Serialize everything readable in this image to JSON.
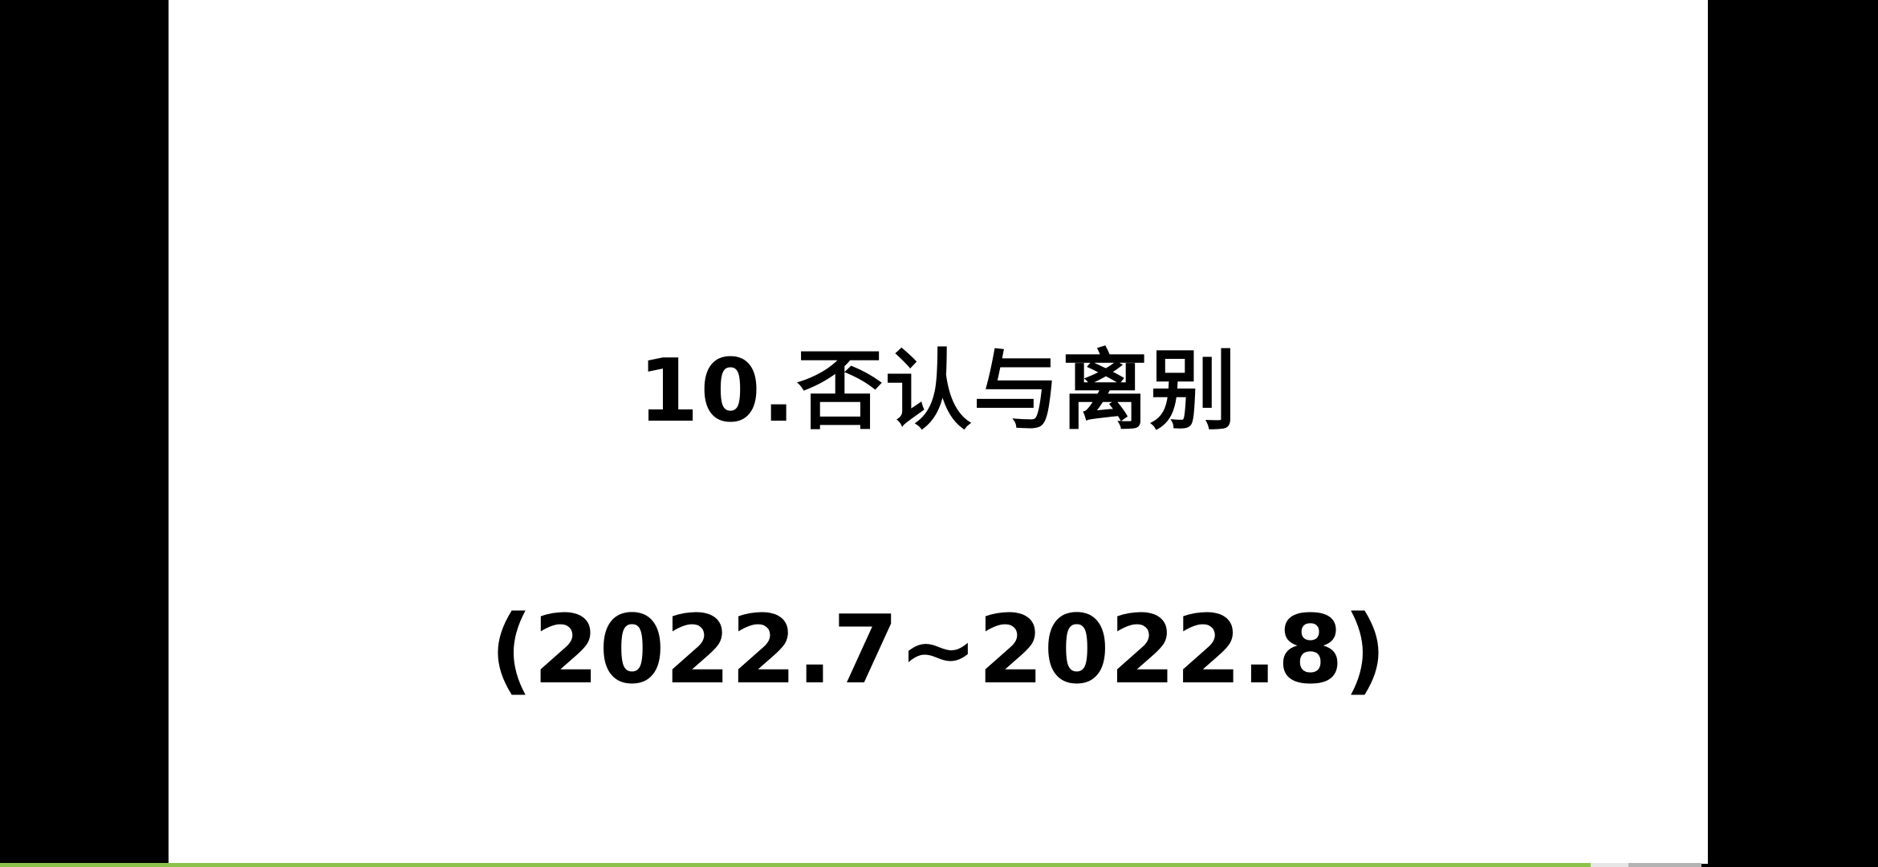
{
  "slide": {
    "title": "10.否认与离别",
    "date_range": "(2022.7~2022.8)"
  },
  "player": {
    "progress_fraction": 0.935,
    "buffered_fraction": 0.957,
    "colors": {
      "played": "#8bc34a",
      "buffered": "#e6e6e6",
      "track": "#b3b3b3"
    }
  }
}
